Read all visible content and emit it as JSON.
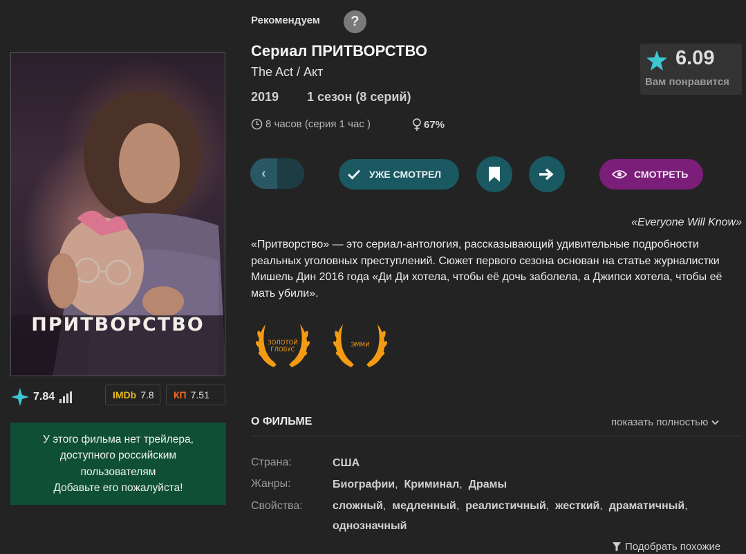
{
  "header": {
    "recommend_label": "Рекомендуем",
    "help_label": "?"
  },
  "movie": {
    "title": "Сериал ПРИТВОРСТВО",
    "original_title": "The Act / Акт",
    "year": "2019",
    "seasons": "1 сезон (8 серий)",
    "duration": "8 часов  (серия 1 час )",
    "female_audience": "67%",
    "score": "6.09",
    "score_caption": "Вам понравится"
  },
  "poster": {
    "title_text": "ПРИТВОРСТВО"
  },
  "ratings": {
    "site": "7.84",
    "imdb_label": "IMDb",
    "imdb": "7.8",
    "kp_label": "КП",
    "kp": "7.51"
  },
  "trailer_notice": [
    "У этого фильма нет трейлера,",
    "доступного российским",
    "пользователям",
    "Добавьте его пожалуйста!"
  ],
  "actions": {
    "watched_label": "УЖЕ СМОТРЕЛ",
    "watch_label": "СМОТРЕТЬ"
  },
  "tagline": "«Everyone Will Know»",
  "description": "«Притворство» — это сериал-антология, рассказывающий удивительные подробности реальных уголовных преступлений. Сюжет первого сезона основан на статье журналистки Мишель Дин 2016 года «Ди Ди хотела, чтобы её дочь заболела, а Джипси хотела, чтобы её мать убили».",
  "awards": [
    {
      "line1": "ЗОЛОТОЙ",
      "line2": "ГЛОБУС"
    },
    {
      "line1": "ЭММИ",
      "line2": ""
    }
  ],
  "about": {
    "heading": "О ФИЛЬМЕ",
    "show_full": "показать полностью",
    "country_label": "Страна:",
    "country": "США",
    "genres_label": "Жанры:",
    "genres": [
      "Биографии",
      "Криминал",
      "Драмы"
    ],
    "props_label": "Свойства:",
    "props": [
      "сложный",
      "медленный",
      "реалистичный",
      "жесткий",
      "драматичный",
      "однозначный"
    ],
    "similar": "Подобрать похожие"
  },
  "colors": {
    "background": "#232323",
    "teal_button": "#1a5862",
    "purple_button": "#7a1e7a",
    "green_notice": "#0e4f35",
    "award_gold": "#f39b14",
    "imdb_yellow": "#e6b91e",
    "kp_orange": "#f26a1b",
    "star_cyan": "#3ec6d1"
  }
}
